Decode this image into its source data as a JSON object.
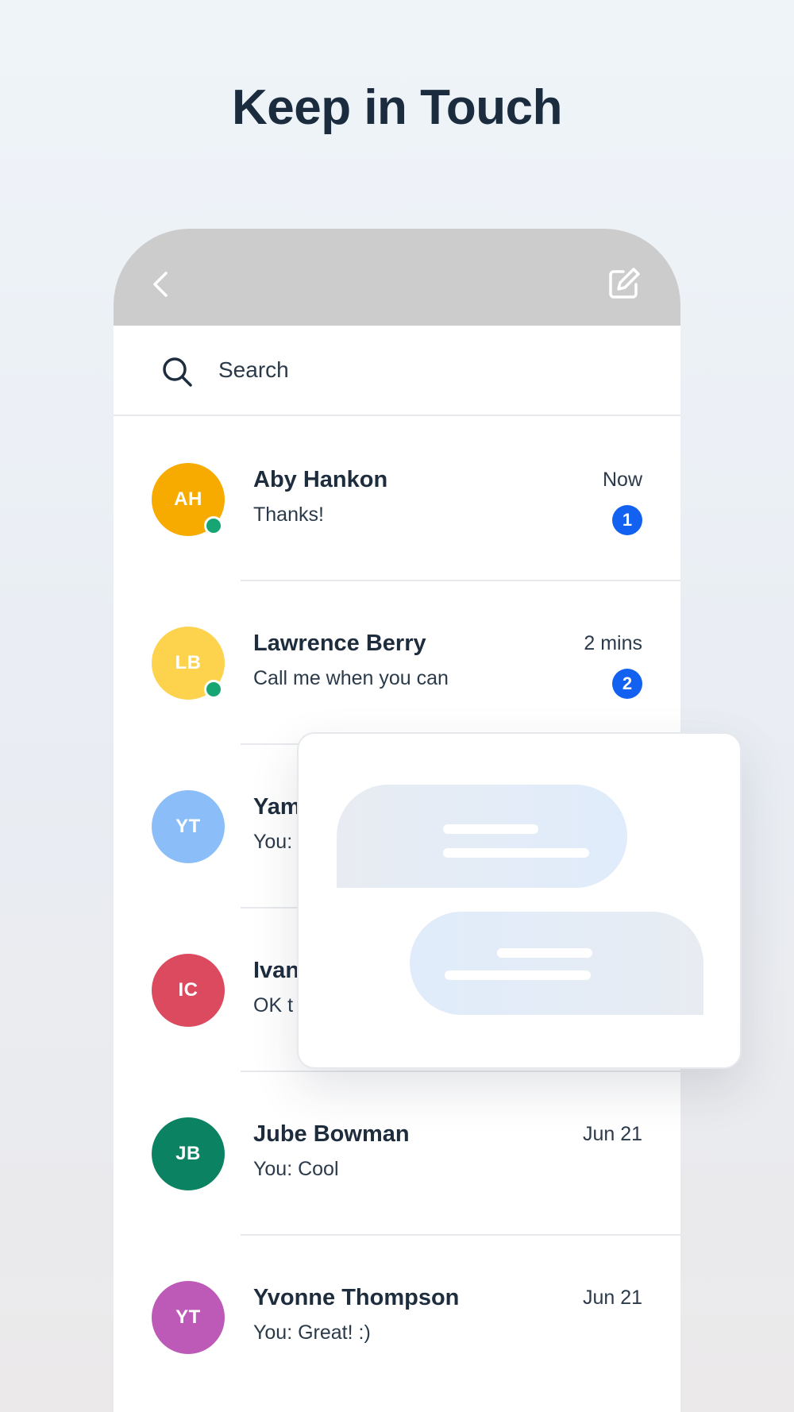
{
  "headline": "Keep in Touch",
  "header": {
    "back_icon": "chevron-left-icon",
    "compose_icon": "compose-icon"
  },
  "search": {
    "placeholder": "Search",
    "icon": "search-icon"
  },
  "conversations": [
    {
      "initials": "AH",
      "name": "Aby Hankon",
      "preview": "Thanks!",
      "time": "Now",
      "unread": "1",
      "online": true,
      "color": "#f7ab00"
    },
    {
      "initials": "LB",
      "name": "Lawrence Berry",
      "preview": "Call me when you can",
      "time": "2 mins",
      "unread": "2",
      "online": true,
      "color": "#fdd24d"
    },
    {
      "initials": "YT",
      "name": "Yam",
      "preview": "You:",
      "time": "",
      "unread": "",
      "online": false,
      "color": "#8bbdf8"
    },
    {
      "initials": "IC",
      "name": "Ivan",
      "preview": "OK t",
      "time": "",
      "unread": "",
      "online": false,
      "color": "#dc4a5f"
    },
    {
      "initials": "JB",
      "name": "Jube Bowman",
      "preview": "You: Cool",
      "time": "Jun 21",
      "unread": "",
      "online": false,
      "color": "#0b8262"
    },
    {
      "initials": "YT",
      "name": "Yvonne Thompson",
      "preview": "You: Great! :)",
      "time": "Jun 21",
      "unread": "",
      "online": false,
      "color": "#bd59b6"
    }
  ],
  "colors": {
    "header_bg": "#cccccc",
    "badge": "#1261f0",
    "online": "#17a673",
    "text_dark": "#1e2d3e"
  }
}
